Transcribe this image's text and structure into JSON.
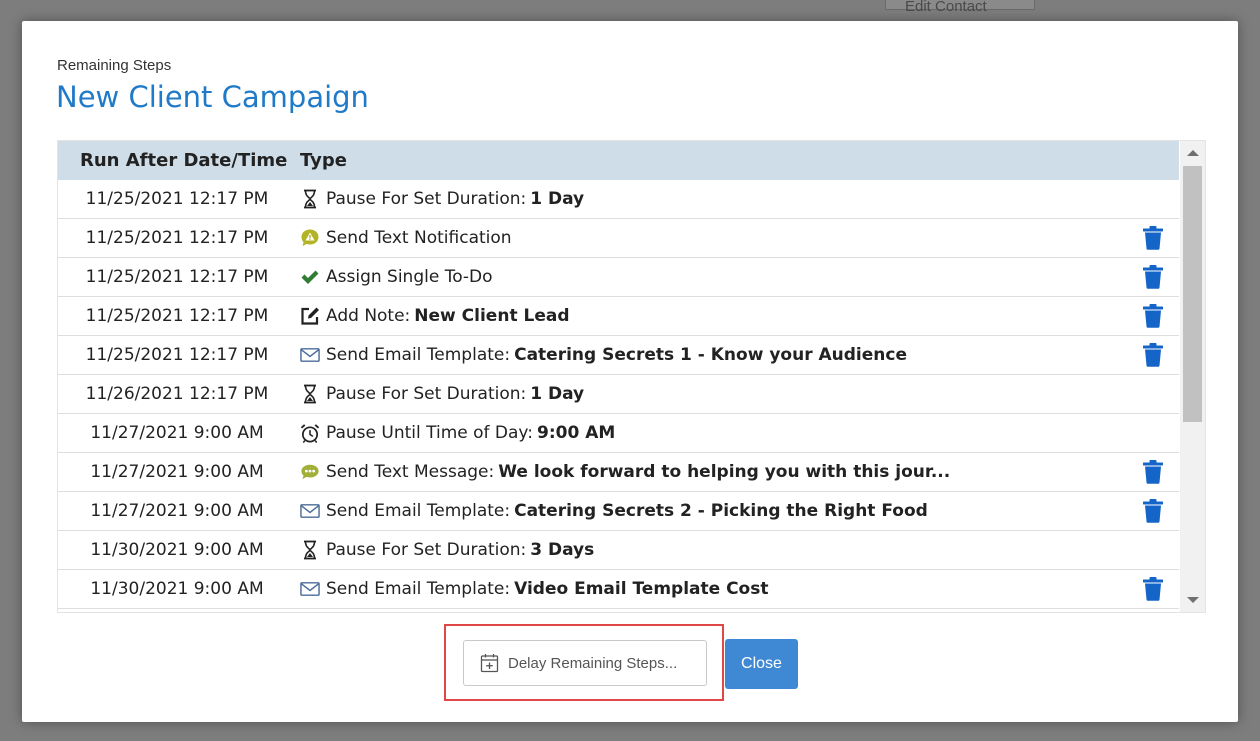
{
  "background": {
    "edit_contact_label": "Edit Contact"
  },
  "modal": {
    "subtitle": "Remaining Steps",
    "title": "New Client Campaign",
    "table": {
      "columns": [
        "Run After Date/Time",
        "Type"
      ],
      "rows": [
        {
          "date": "11/25/2021 12:17 PM",
          "icon": "hourglass-icon",
          "label": "Pause For Set Duration:",
          "value": "1 Day",
          "deletable": false
        },
        {
          "date": "11/25/2021 12:17 PM",
          "icon": "alert-bubble-icon",
          "label": "Send Text Notification",
          "value": "",
          "deletable": true
        },
        {
          "date": "11/25/2021 12:17 PM",
          "icon": "checkmark-icon",
          "label": "Assign Single To-Do",
          "value": "",
          "deletable": true
        },
        {
          "date": "11/25/2021 12:17 PM",
          "icon": "edit-note-icon",
          "label": "Add Note:",
          "value": "New Client Lead",
          "deletable": true
        },
        {
          "date": "11/25/2021 12:17 PM",
          "icon": "envelope-icon",
          "label": "Send Email Template:",
          "value": "Catering Secrets 1 - Know your Audience",
          "deletable": true
        },
        {
          "date": "11/26/2021 12:17 PM",
          "icon": "hourglass-icon",
          "label": "Pause For Set Duration:",
          "value": "1 Day",
          "deletable": false
        },
        {
          "date": "11/27/2021 9:00 AM",
          "icon": "alarm-clock-icon",
          "label": "Pause Until Time of Day:",
          "value": "9:00 AM",
          "deletable": false
        },
        {
          "date": "11/27/2021 9:00 AM",
          "icon": "chat-bubble-icon",
          "label": "Send Text Message:",
          "value": "We look forward to helping you with this jour...",
          "deletable": true
        },
        {
          "date": "11/27/2021 9:00 AM",
          "icon": "envelope-icon",
          "label": "Send Email Template:",
          "value": "Catering Secrets 2 - Picking the Right Food",
          "deletable": true
        },
        {
          "date": "11/30/2021 9:00 AM",
          "icon": "hourglass-icon",
          "label": "Pause For Set Duration:",
          "value": "3 Days",
          "deletable": false
        },
        {
          "date": "11/30/2021 9:00 AM",
          "icon": "envelope-icon",
          "label": "Send Email Template:",
          "value": "Video Email Template Cost",
          "deletable": true
        }
      ]
    },
    "buttons": {
      "delay": "Delay Remaining Steps...",
      "close": "Close"
    }
  },
  "colors": {
    "title": "#1f7ac8",
    "header_bg": "#cfdde8",
    "trash": "#1565c8",
    "close_button": "#3f89d4",
    "highlight": "#e04848"
  }
}
